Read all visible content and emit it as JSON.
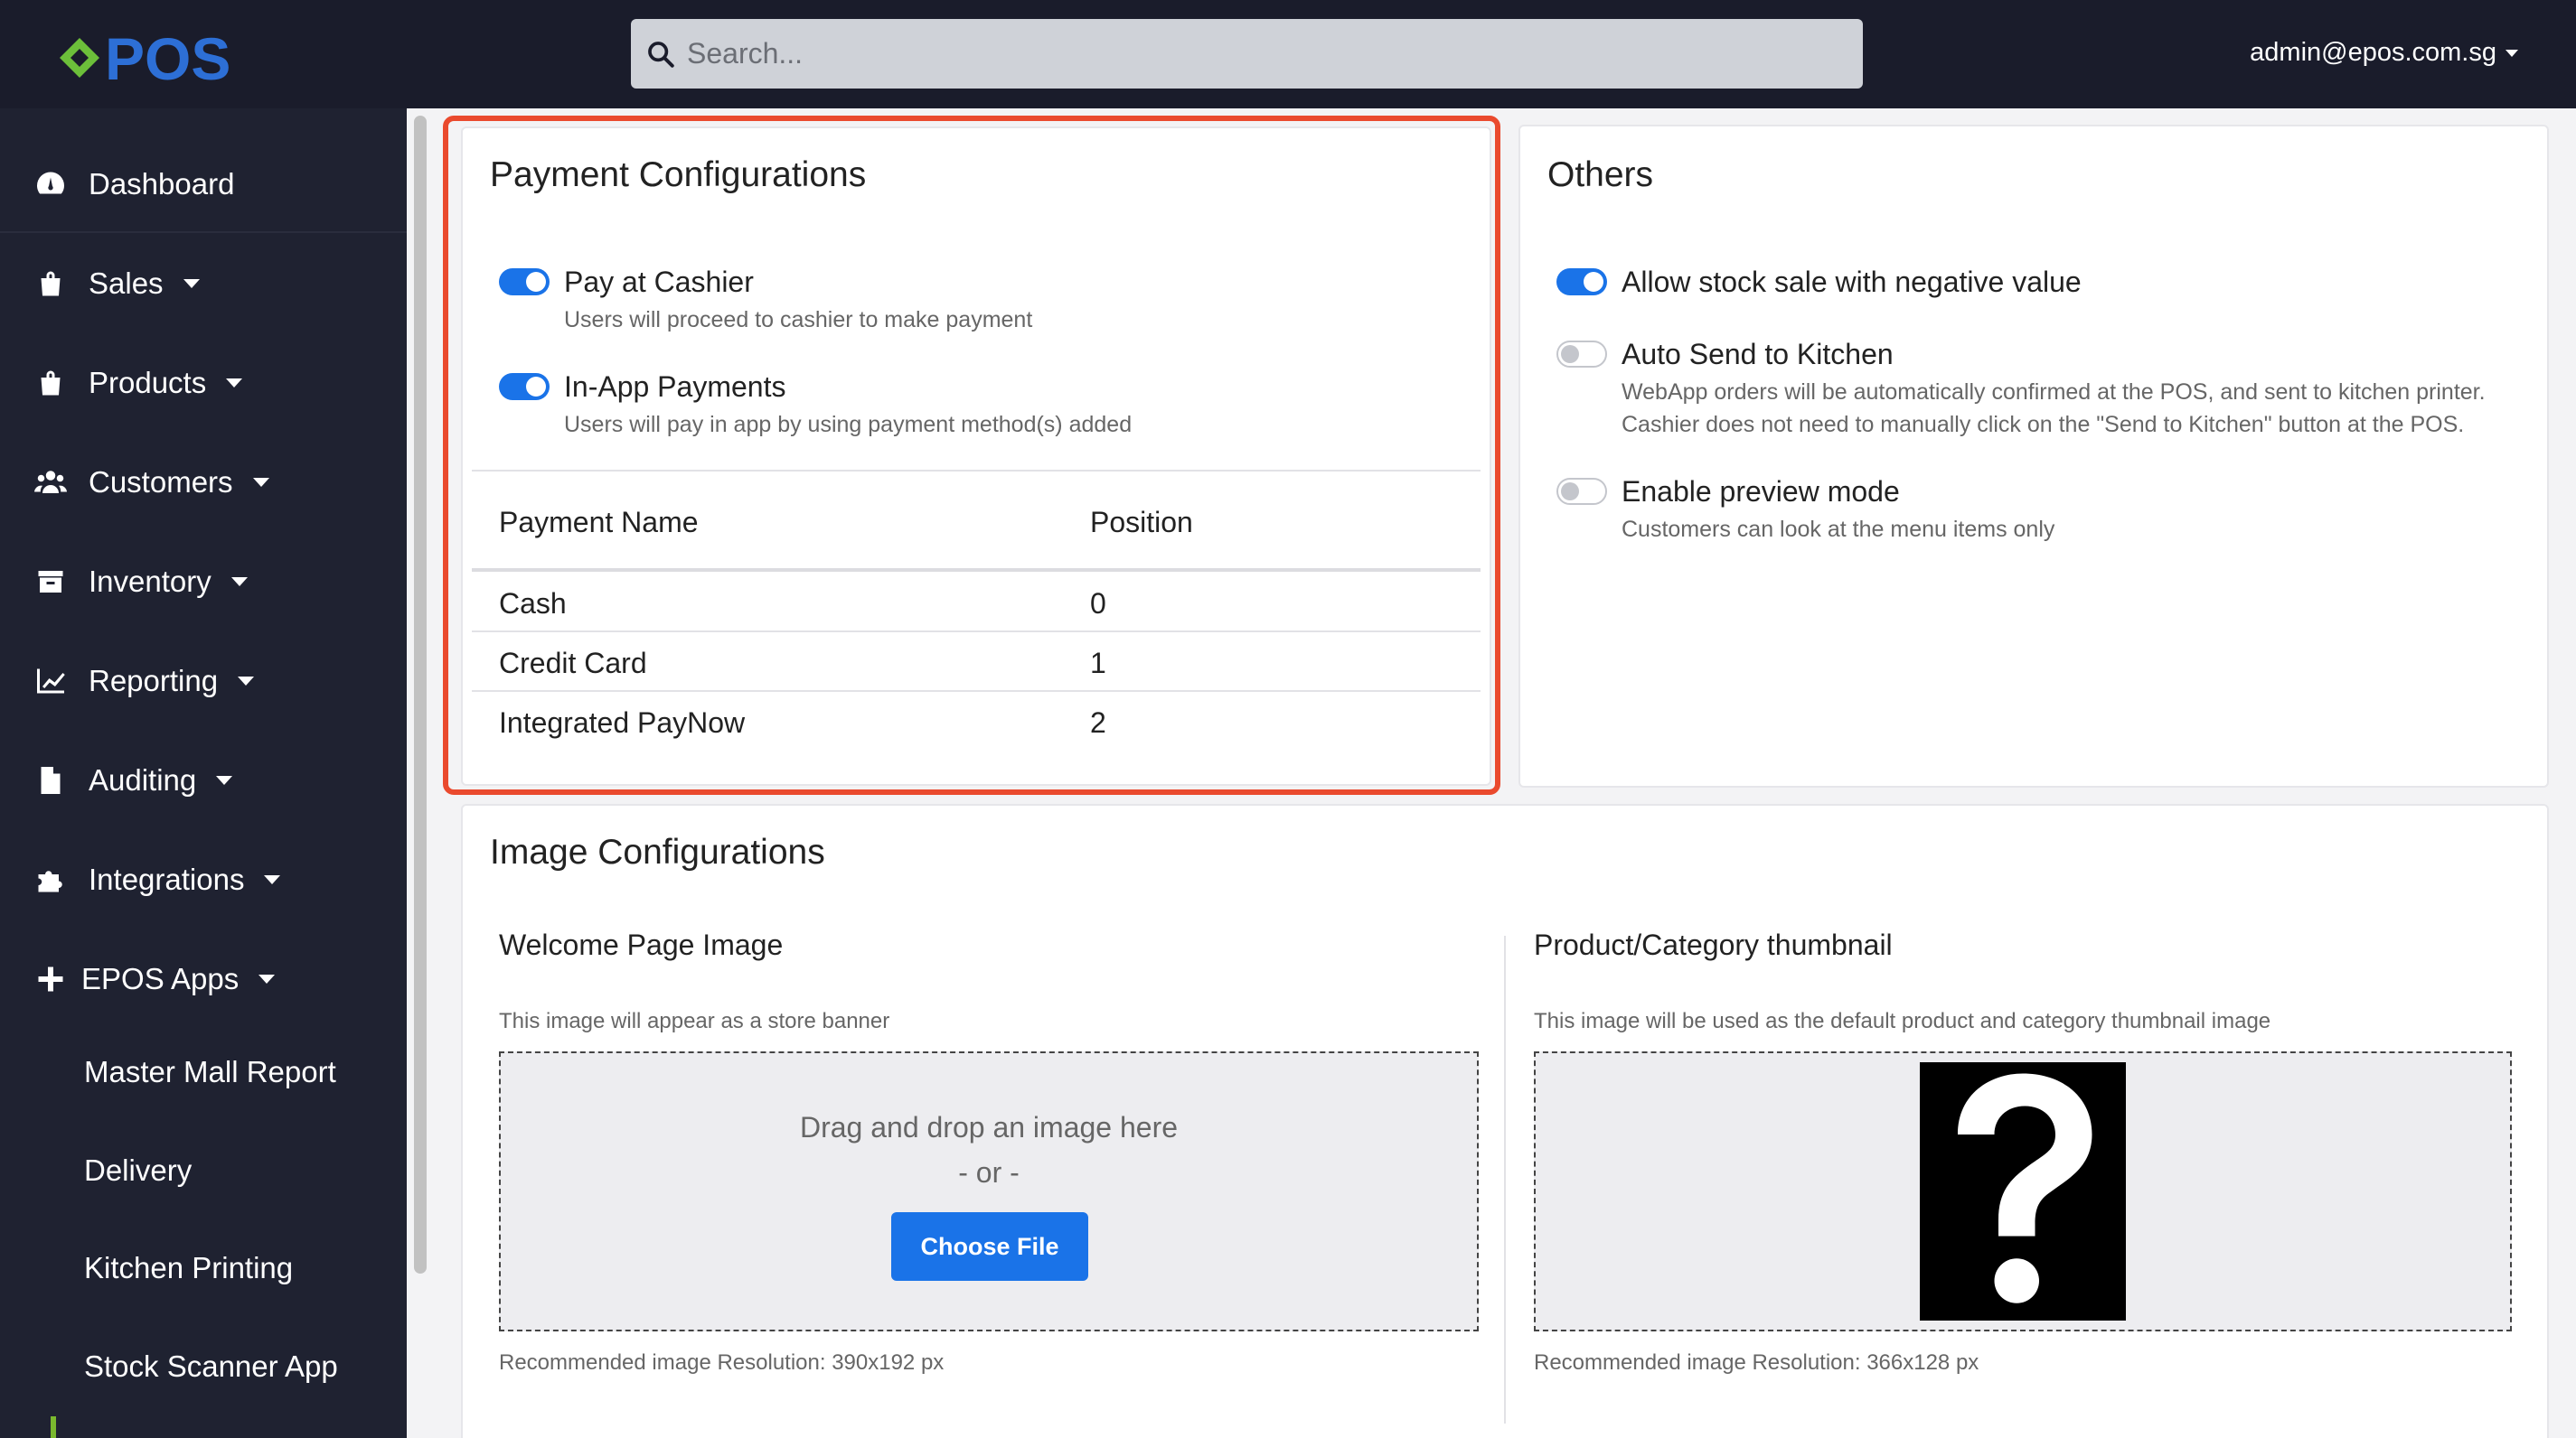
{
  "header": {
    "search_placeholder": "Search...",
    "user_email": "admin@epos.com.sg"
  },
  "sidebar": {
    "items": [
      {
        "label": "Dashboard",
        "icon": "dashboard-icon"
      },
      {
        "label": "Sales",
        "icon": "shopping-bag-icon",
        "has_caret": true
      },
      {
        "label": "Products",
        "icon": "shopping-bag-icon",
        "has_caret": true
      },
      {
        "label": "Customers",
        "icon": "users-icon",
        "has_caret": true
      },
      {
        "label": "Inventory",
        "icon": "archive-icon",
        "has_caret": true
      },
      {
        "label": "Reporting",
        "icon": "chart-line-icon",
        "has_caret": true
      },
      {
        "label": "Auditing",
        "icon": "file-icon",
        "has_caret": true
      },
      {
        "label": "Integrations",
        "icon": "puzzle-icon",
        "has_caret": true
      },
      {
        "label": "EPOS Apps",
        "icon": "plus-icon",
        "has_caret": true
      }
    ],
    "subitems": [
      "Master Mall Report",
      "Delivery",
      "Kitchen Printing",
      "Stock Scanner App"
    ]
  },
  "payment": {
    "title": "Payment Configurations",
    "options": [
      {
        "label": "Pay at Cashier",
        "desc": "Users will proceed to cashier to make payment",
        "enabled": true
      },
      {
        "label": "In-App Payments",
        "desc": "Users will pay in app by using payment method(s) added",
        "enabled": true
      }
    ],
    "table": {
      "headers": [
        "Payment Name",
        "Position"
      ],
      "rows": [
        [
          "Cash",
          "0"
        ],
        [
          "Credit Card",
          "1"
        ],
        [
          "Integrated PayNow",
          "2"
        ]
      ]
    }
  },
  "others": {
    "title": "Others",
    "options": [
      {
        "label": "Allow stock sale with negative value",
        "desc": "",
        "enabled": true
      },
      {
        "label": "Auto Send to Kitchen",
        "desc_line1": "WebApp orders will be automatically confirmed at the POS, and sent to kitchen printer.",
        "desc_line2": "Cashier does not need to manually click on the \"Send to Kitchen\" button at the POS.",
        "enabled": false
      },
      {
        "label": "Enable preview mode",
        "desc": "Customers can look at the menu items only",
        "enabled": false
      }
    ]
  },
  "images": {
    "title": "Image Configurations",
    "welcome": {
      "title": "Welcome Page Image",
      "desc": "This image will appear as a store banner",
      "drop_text": "Drag and drop an image here",
      "or_text": "- or -",
      "button": "Choose File",
      "resolution": "Recommended image Resolution: 390x192 px"
    },
    "thumbnail": {
      "title": "Product/Category thumbnail",
      "desc": "This image will be used as the default product and category thumbnail image",
      "resolution": "Recommended image Resolution: 366x128 px"
    }
  },
  "colors": {
    "accent": "#1a73e8",
    "highlight": "#ea4a2e",
    "sidebar": "#1f2231",
    "topbar": "#1a1c2b"
  }
}
